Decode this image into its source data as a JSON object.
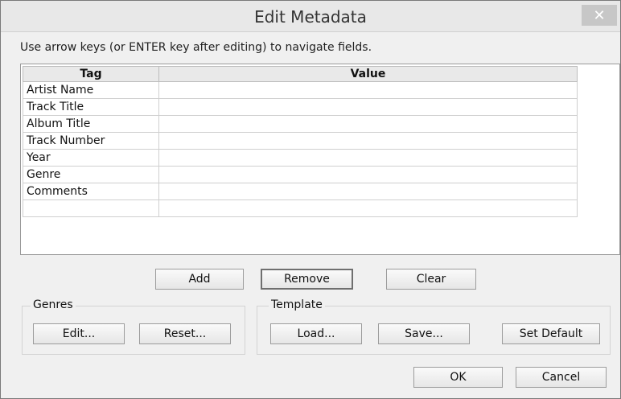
{
  "window": {
    "title": "Edit Metadata",
    "close_glyph": "✕"
  },
  "hint": "Use arrow keys (or ENTER key after editing) to navigate fields.",
  "table": {
    "columns": [
      "Tag",
      "Value"
    ],
    "rows": [
      {
        "tag": "Artist Name",
        "value": ""
      },
      {
        "tag": "Track Title",
        "value": ""
      },
      {
        "tag": "Album Title",
        "value": ""
      },
      {
        "tag": "Track Number",
        "value": ""
      },
      {
        "tag": "Year",
        "value": ""
      },
      {
        "tag": "Genre",
        "value": ""
      },
      {
        "tag": "Comments",
        "value": ""
      },
      {
        "tag": "",
        "value": ""
      }
    ]
  },
  "row_buttons": {
    "add": "Add",
    "remove": "Remove",
    "clear": "Clear"
  },
  "genres": {
    "label": "Genres",
    "edit": "Edit...",
    "reset": "Reset..."
  },
  "template": {
    "label": "Template",
    "load": "Load...",
    "save": "Save...",
    "set_default": "Set Default"
  },
  "footer": {
    "ok": "OK",
    "cancel": "Cancel"
  }
}
